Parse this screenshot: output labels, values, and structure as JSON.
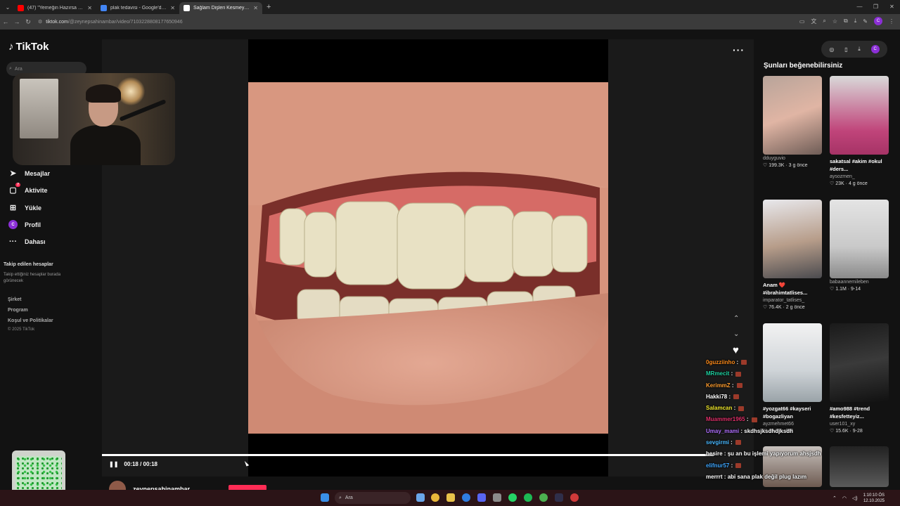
{
  "browser": {
    "tabs": [
      {
        "title": "(47) \"Yemeğin Hazırsa Video H",
        "active": false,
        "color": "#ff0000"
      },
      {
        "title": "plak tedavisi - Google'da Ara",
        "active": false,
        "color": "#4285f4"
      },
      {
        "title": "Sağlam Dişleri Kesmeyin - ",
        "active": true,
        "color": "#ffffff"
      }
    ],
    "url_host": "tiktok.com",
    "url_path": "/@zeynepsahinambar/video/7103228808177650946"
  },
  "sidebar": {
    "logo": "TikTok",
    "search_placeholder": "Ara",
    "items": [
      {
        "label": "Mesajlar",
        "icon": "paper-plane-icon"
      },
      {
        "label": "Aktivite",
        "icon": "activity-icon",
        "badge": "7"
      },
      {
        "label": "Yükle",
        "icon": "upload-icon"
      },
      {
        "label": "Profil",
        "icon": "avatar-icon",
        "avatar_letter": "C"
      },
      {
        "label": "Dahası",
        "icon": "more-icon"
      }
    ],
    "following_heading": "Takip edilen hesaplar",
    "following_text": "Takip ettiğiniz hesaplar burada görünecek",
    "footer_links": [
      "Şirket",
      "Program",
      "Koşul ve Politikalar"
    ],
    "copyright": "© 2025 TikTok"
  },
  "player": {
    "time": "00:18 / 00:18",
    "progress": 1.0,
    "author": "zeynepsahinambar"
  },
  "right_panel": {
    "title": "Şunları beğenebilirsiniz",
    "cards": [
      {
        "caption": "",
        "user": "dduyguvio",
        "likes": "199.3K",
        "age": "3 g önce"
      },
      {
        "caption": "sakatsal #akim #okul #ders...",
        "user": "aysozmen_",
        "likes": "23K",
        "age": "4 g önce"
      },
      {
        "caption": "Anam ❤️ #ibrahimtatlises...",
        "user": "imparator_tatlises_",
        "likes": "76.4K",
        "age": "2 g önce"
      },
      {
        "caption": "",
        "user": "babaannemileben",
        "likes": "1.1M",
        "age": "9-14"
      },
      {
        "caption": "#yozgat66 #kayseri #bogazliyan",
        "user": "ayzmehmet66",
        "likes": "26.8K",
        "age": "9-8"
      },
      {
        "caption": "#amo988 #trend #kesfetteyiz...",
        "user": "user101_xy",
        "likes": "15.6K",
        "age": "9-28"
      }
    ]
  },
  "chat": [
    {
      "user": "0guzziinho",
      "color": "#ff8c1a",
      "msg": ""
    },
    {
      "user": "MRmecit",
      "color": "#1fd1a0",
      "msg": ""
    },
    {
      "user": "KerimmZ",
      "color": "#ff9d2e",
      "msg": ""
    },
    {
      "user": "Hakki78",
      "color": "#ffffff",
      "msg": ""
    },
    {
      "user": "Salamcan",
      "color": "#f0e82c",
      "msg": ""
    },
    {
      "user": "Muammer1965",
      "color": "#e0306a",
      "msg": ""
    },
    {
      "user": "Umay_mami",
      "color": "#b070ff",
      "msg": "skdhsjksdhdjksdh"
    },
    {
      "user": "sevgirmi",
      "color": "#49b8ff",
      "msg": ""
    },
    {
      "user": "hesire",
      "color": "#ffffff",
      "msg": "şu an bu işlemi yapıyorum ahsjsdh"
    },
    {
      "user": "elifnur57",
      "color": "#3ea6ff",
      "msg": ""
    },
    {
      "user": "merrrt",
      "color": "#ffffff",
      "msg": "abi sana plak değil plug lazım"
    }
  ],
  "taskbar": {
    "search_placeholder": "Ara",
    "time": "1:10:10 ÖS",
    "date": "12.10.2025"
  }
}
